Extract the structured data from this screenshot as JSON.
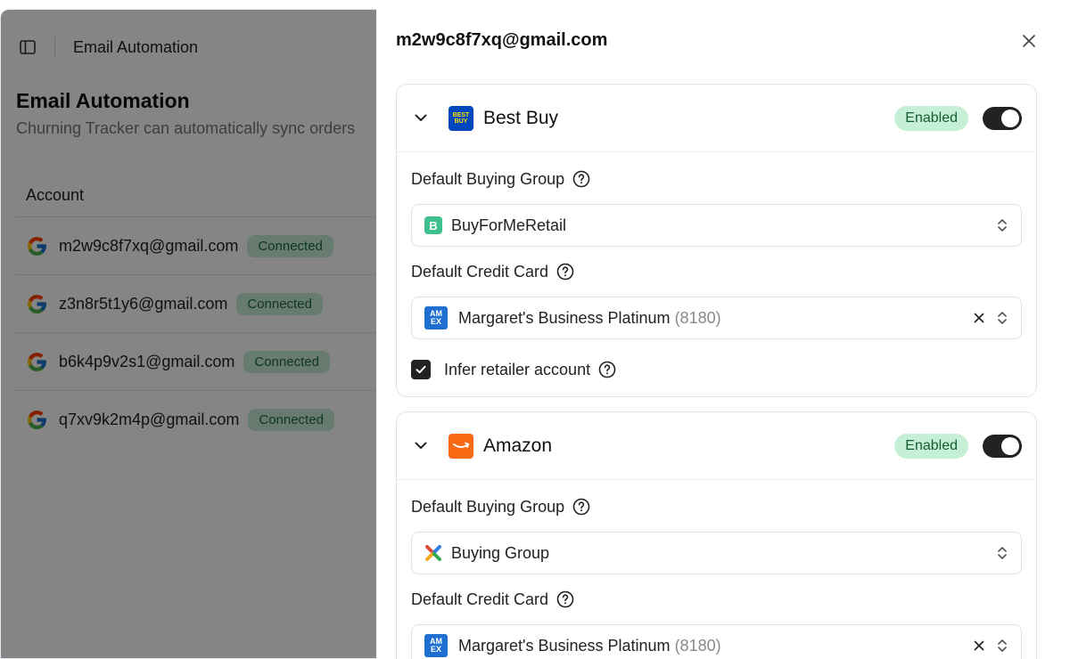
{
  "header": {
    "breadcrumb": "Email Automation"
  },
  "page": {
    "title": "Email Automation",
    "description": "Churning Tracker can automatically sync orders"
  },
  "accounts_table": {
    "column_header": "Account",
    "rows": [
      {
        "email": "m2w9c8f7xq@gmail.com",
        "status": "Connected"
      },
      {
        "email": "z3n8r5t1y6@gmail.com",
        "status": "Connected"
      },
      {
        "email": "b6k4p9v2s1@gmail.com",
        "status": "Connected"
      },
      {
        "email": "q7xv9k2m4p@gmail.com",
        "status": "Connected"
      }
    ]
  },
  "dialog": {
    "title": "m2w9c8f7xq@gmail.com",
    "retailers": [
      {
        "name": "Best Buy",
        "logo_text": "BEST BUY",
        "status": "Enabled",
        "enabled": true,
        "buying_group_label": "Default Buying Group",
        "buying_group_value": "BuyForMeRetail",
        "credit_card_label": "Default Credit Card",
        "credit_card_name": "Margaret's Business Platinum",
        "credit_card_last4": "(8180)",
        "infer_label": "Infer retailer account",
        "infer_checked": true
      },
      {
        "name": "Amazon",
        "status": "Enabled",
        "enabled": true,
        "buying_group_label": "Default Buying Group",
        "buying_group_value": "Buying Group",
        "credit_card_label": "Default Credit Card",
        "credit_card_name": "Margaret's Business Platinum",
        "credit_card_last4": "(8180)"
      }
    ]
  },
  "colors": {
    "connected_bg": "#c7ecd6",
    "enabled_bg": "#c6f0d6",
    "bestbuy_blue": "#0046be",
    "amazon_orange": "#fa6a14",
    "amex_blue": "#1f6fd1"
  },
  "icons": [
    "sidebar-toggle-icon",
    "google-icon",
    "close-icon",
    "chevron-down-icon",
    "help-icon",
    "selector-icon",
    "clear-icon",
    "check-icon"
  ]
}
